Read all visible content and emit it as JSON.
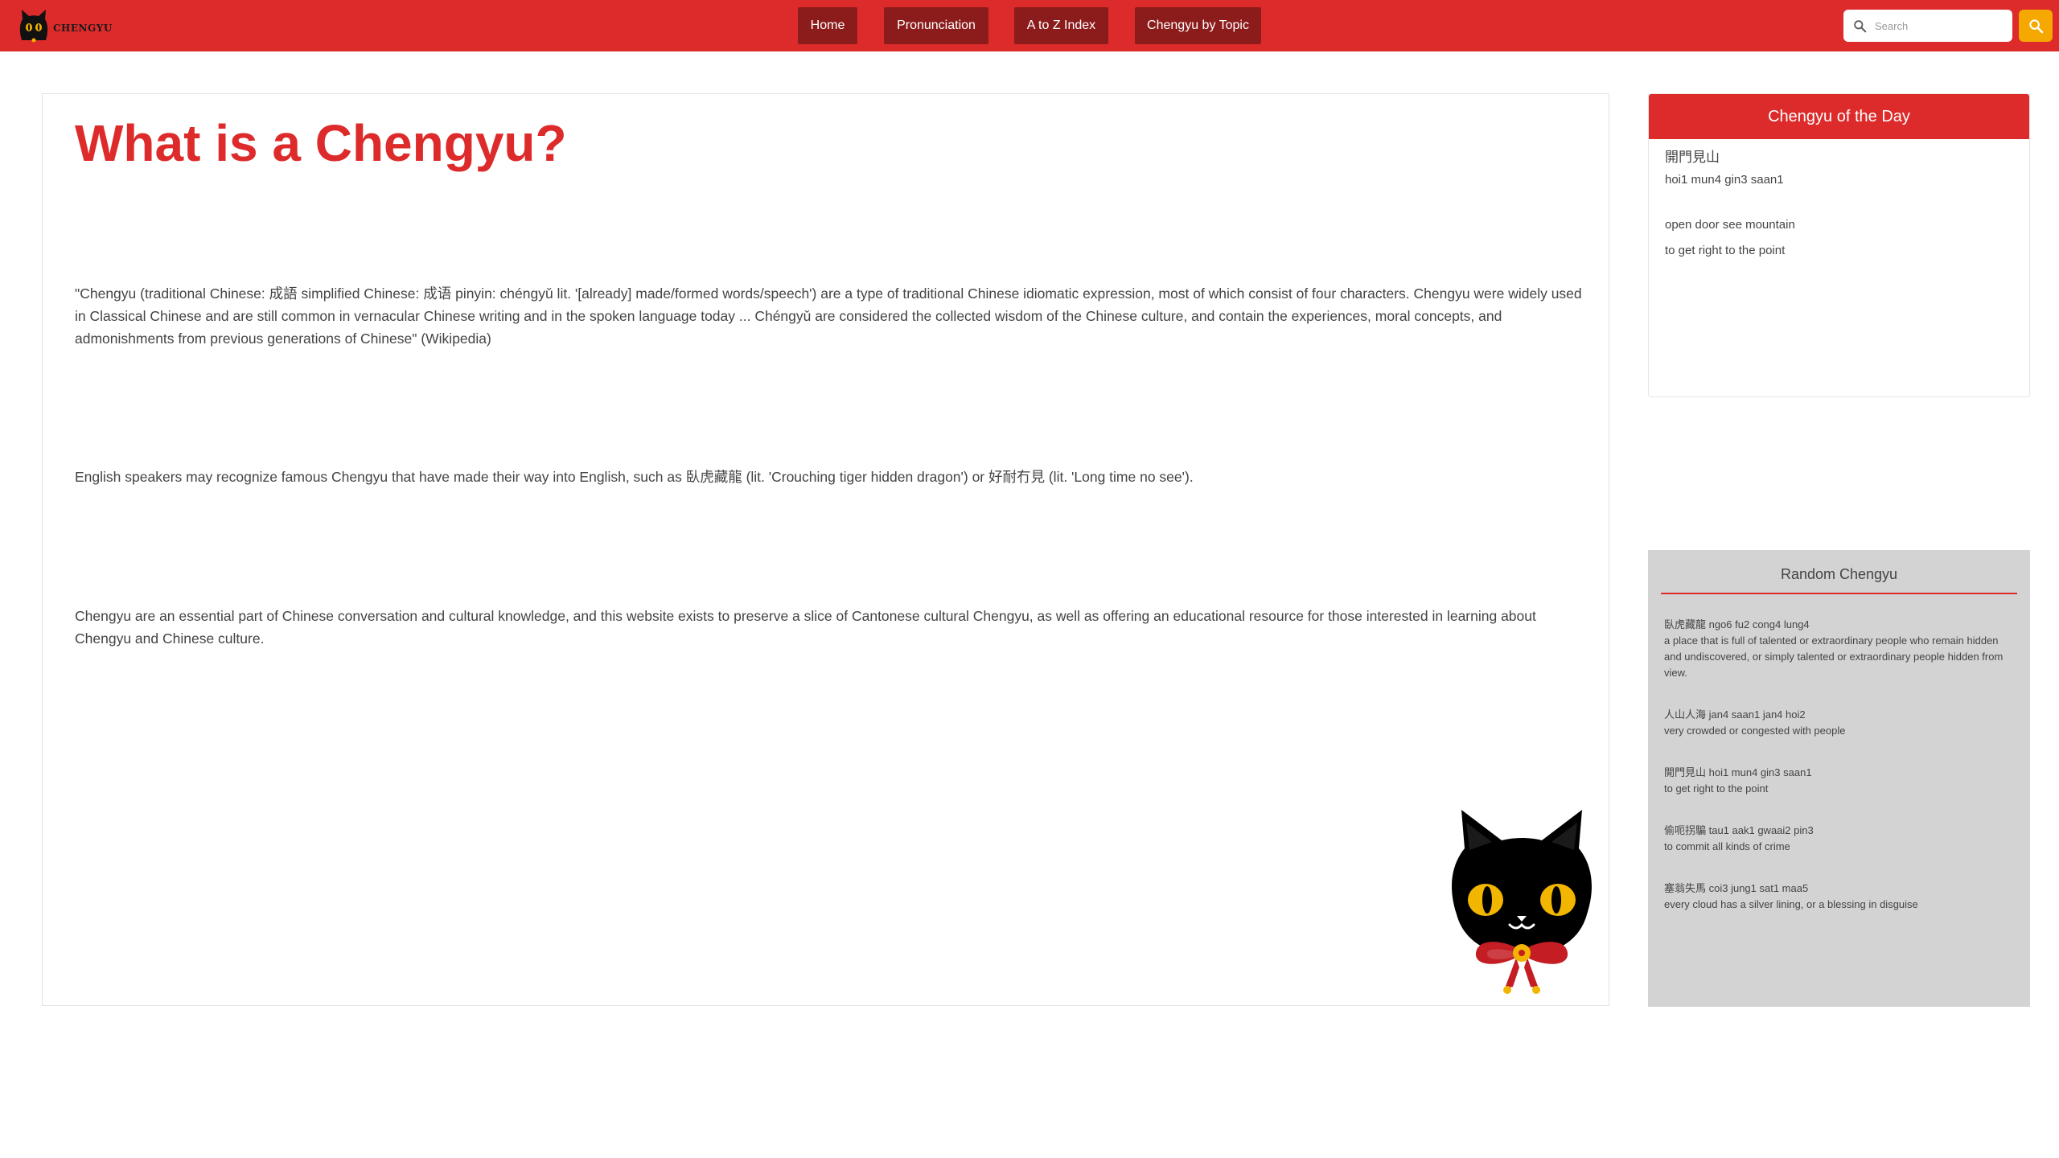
{
  "nav": {
    "logo_text": "CHENGYU",
    "items": [
      {
        "label": "Home"
      },
      {
        "label": "Pronunciation"
      },
      {
        "label": "A to Z Index"
      },
      {
        "label": "Chengyu by Topic"
      }
    ],
    "search_placeholder": "Search"
  },
  "main": {
    "title": "What is a Chengyu?",
    "paragraphs": [
      "\"Chengyu (traditional Chinese: 成語 simplified Chinese: 成语 pinyin: chéngyǔ lit. '[already] made/formed words/speech') are a type of traditional Chinese idiomatic expression, most of which consist of four characters. Chengyu were widely used in Classical Chinese and are still common in vernacular Chinese writing and in the spoken language today ... Chéngyǔ are considered the collected wisdom of the Chinese culture, and contain the experiences, moral concepts, and admonishments from previous generations of Chinese\" (Wikipedia)",
      "English speakers may recognize famous Chengyu that have made their way into English, such as 臥虎藏龍 (lit. 'Crouching tiger hidden dragon') or 好耐冇見 (lit. 'Long time no see').",
      "Chengyu are an essential part of Chinese conversation and cultural knowledge, and this website exists to preserve a slice of Cantonese cultural Chengyu, as well as offering an educational resource for those interested in learning about Chengyu and Chinese culture."
    ]
  },
  "day": {
    "header": "Chengyu of the Day",
    "chars": "開門見山",
    "jyutping": "hoi1 mun4 gin3 saan1",
    "literal": "open door see mountain",
    "meaning": "to get right to the point"
  },
  "random": {
    "title": "Random Chengyu",
    "items": [
      {
        "head": "臥虎藏龍 ngo6 fu2 cong4 lung4",
        "meaning": "a place that is full of talented or extraordinary people who remain hidden and undiscovered, or simply talented or extraordinary people hidden from view."
      },
      {
        "head": "人山人海 jan4 saan1 jan4 hoi2",
        "meaning": "very crowded or congested with people"
      },
      {
        "head": "開門見山 hoi1 mun4 gin3 saan1",
        "meaning": "to get right to the point"
      },
      {
        "head": "偷呃拐騙 tau1 aak1 gwaai2 pin3",
        "meaning": "to commit all kinds of crime"
      },
      {
        "head": "塞翁失馬 coi3 jung1 sat1 maa5",
        "meaning": "every cloud has a silver lining, or a blessing in disguise"
      }
    ]
  },
  "colors": {
    "brand_red": "#dd2a2a",
    "nav_button": "#8c1c1c",
    "search_button": "#f5a800",
    "sidebar_grey": "#d3d3d3"
  },
  "icons": {
    "logo": "black-cat-logo-icon",
    "search": "magnifier-icon",
    "mascot": "black-cat-mascot-icon"
  }
}
